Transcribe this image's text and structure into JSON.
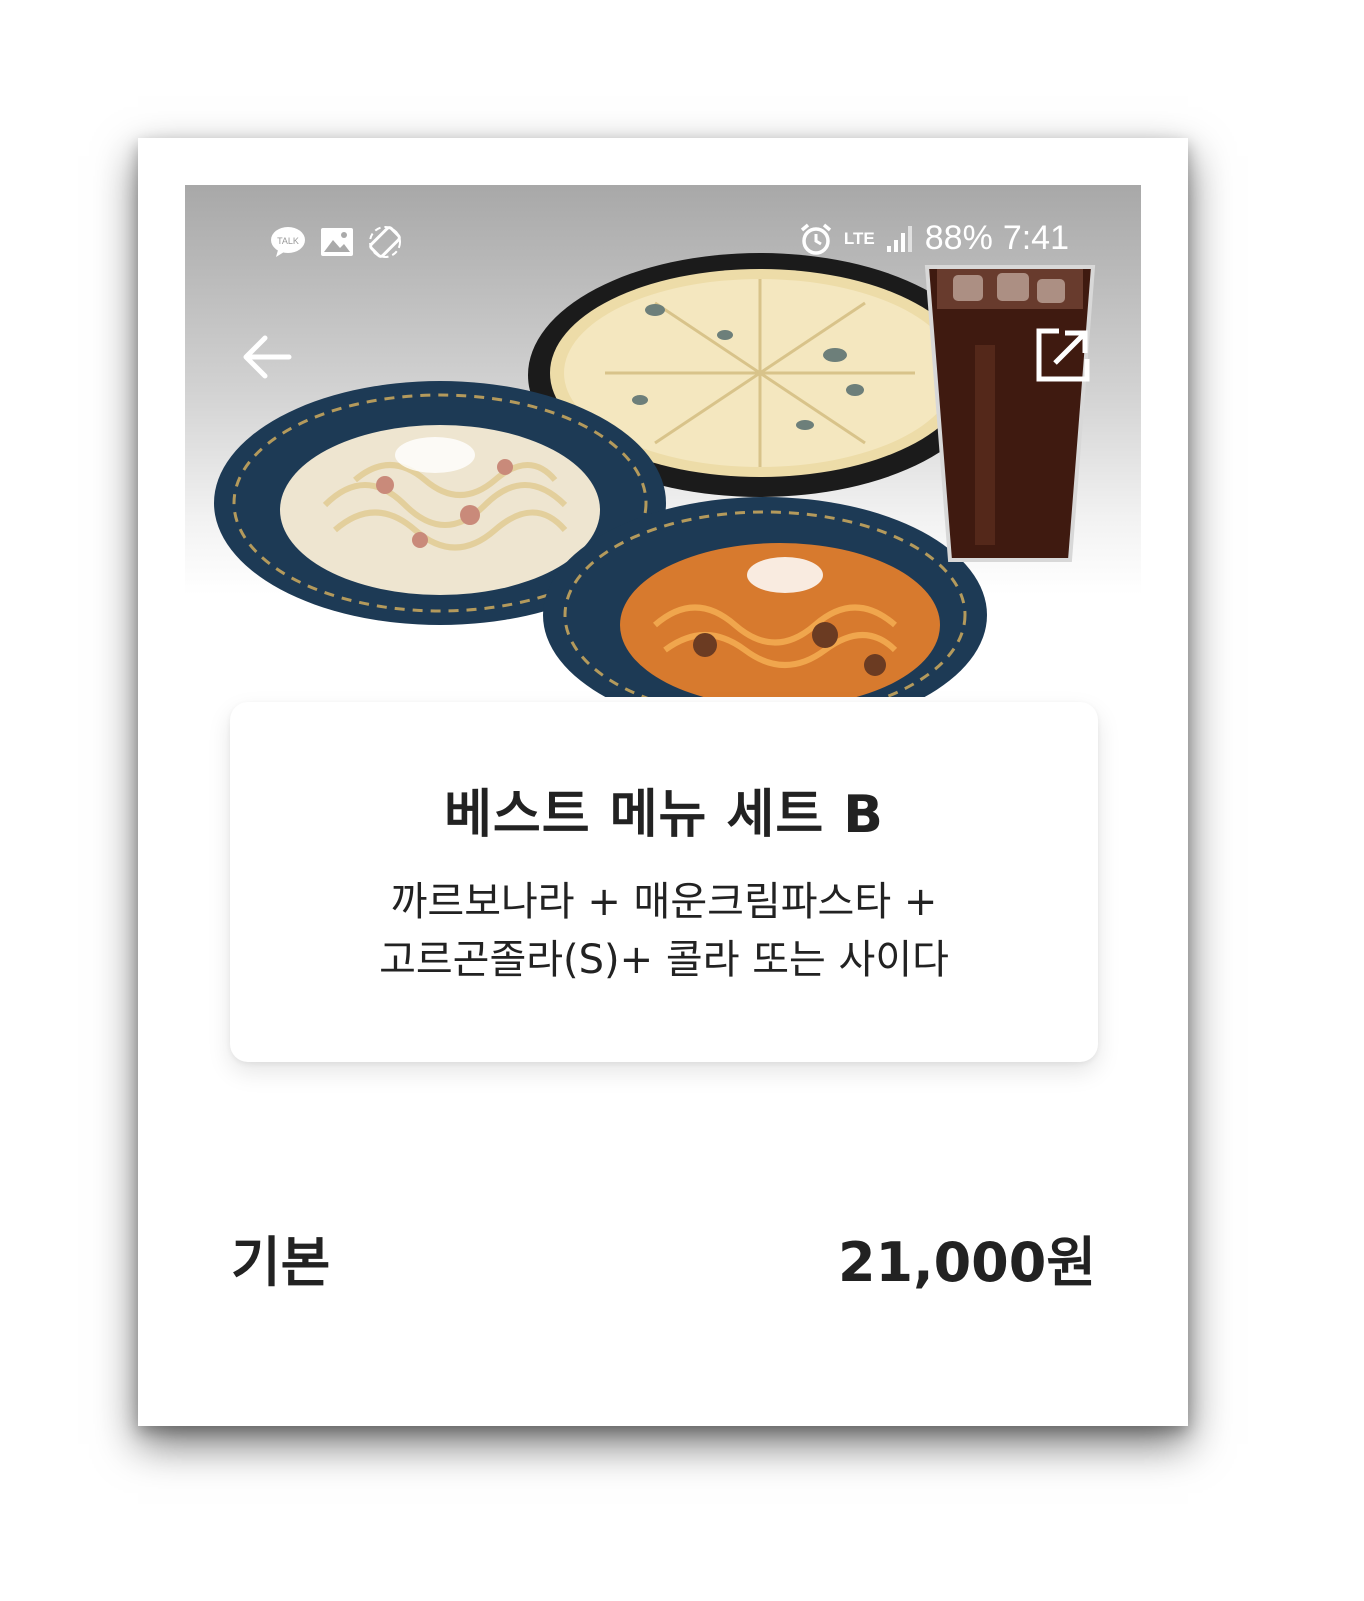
{
  "status_bar": {
    "left_icons": [
      "talk-icon",
      "image-icon",
      "rotate-icon"
    ],
    "talk_label": "TALK",
    "network": "LTE",
    "battery": "88%",
    "time": "7:41"
  },
  "header": {
    "back_icon": "arrow-left-icon",
    "share_icon": "share-external-icon"
  },
  "product": {
    "title": "베스트 메뉴 세트 B",
    "description_line1": "까르보나라 + 매운크림파스타 +",
    "description_line2": "고르곤졸라(S)+ 콜라 또는 사이다"
  },
  "price": {
    "label": "기본",
    "value": "21,000원"
  },
  "colors": {
    "text": "#222222",
    "plate": "#1f3650",
    "pizza": "#f1e2b0",
    "cola": "#4a1c10"
  }
}
